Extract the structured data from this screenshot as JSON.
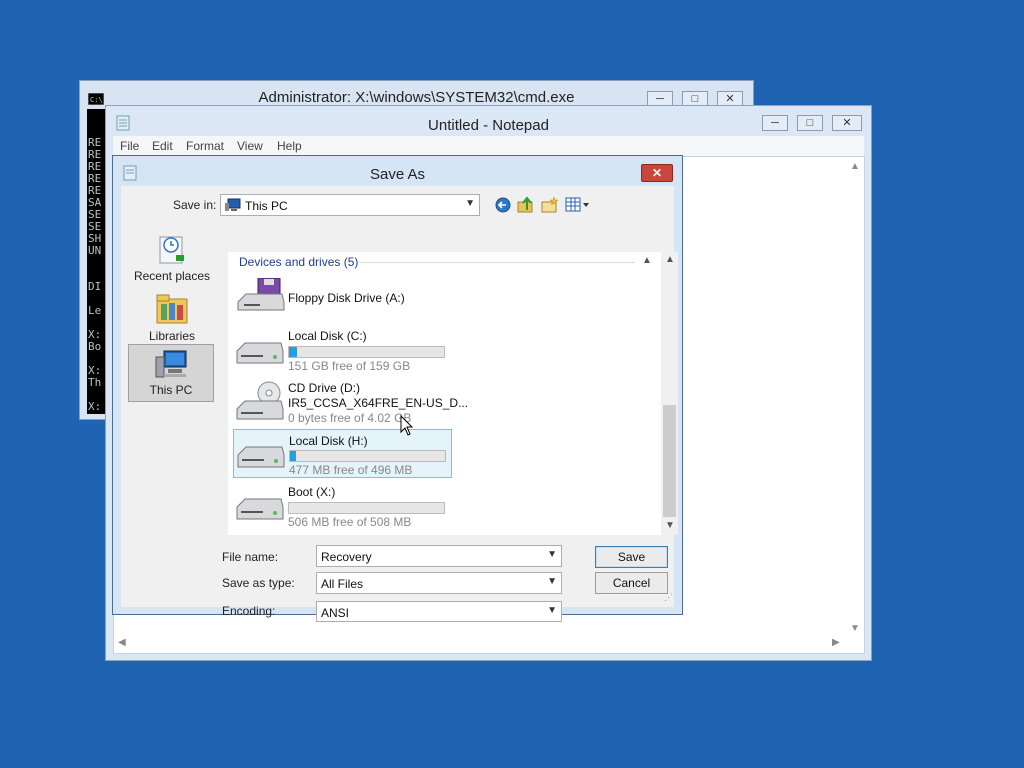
{
  "cmd_window": {
    "title": "Administrator: X:\\windows\\SYSTEM32\\cmd.exe",
    "console_lines": [
      "RE",
      "RE",
      "RE",
      "RE",
      "RE",
      "SA",
      "SE",
      "SE",
      "SH",
      "UN",
      "DI",
      "Le",
      "X:",
      "Bo",
      "X:",
      "Th",
      "X:"
    ]
  },
  "notepad_window": {
    "title": "Untitled - Notepad",
    "menu": [
      "File",
      "Edit",
      "Format",
      "View",
      "Help"
    ]
  },
  "save_dialog": {
    "title": "Save As",
    "save_in_label": "Save in:",
    "save_in_value": "This PC",
    "nav": [
      {
        "label": "Recent places",
        "icon": "recent-places-icon"
      },
      {
        "label": "Libraries",
        "icon": "libraries-icon"
      },
      {
        "label": "This PC",
        "icon": "this-pc-icon",
        "selected": true
      }
    ],
    "group_header": "Devices and drives (5)",
    "drives": [
      {
        "name": "Floppy Disk Drive (A:)",
        "icon": "floppy-drive-icon"
      },
      {
        "name": "Local Disk (C:)",
        "free": "151 GB free of 159 GB",
        "used_fraction": 0.05,
        "icon": "hard-drive-icon"
      },
      {
        "name": "CD Drive (D:)",
        "label": "IR5_CCSA_X64FRE_EN-US_D...",
        "free": "0 bytes free of 4.02 GB",
        "icon": "cd-drive-icon"
      },
      {
        "name": "Local Disk (H:)",
        "free": "477 MB free of 496 MB",
        "used_fraction": 0.04,
        "icon": "hard-drive-icon",
        "selected": true
      },
      {
        "name": "Boot (X:)",
        "free": "506 MB free of 508 MB",
        "used_fraction": 0.0,
        "icon": "hard-drive-icon"
      }
    ],
    "file_name_label": "File name:",
    "file_name_value": "Recovery",
    "save_as_type_label": "Save as type:",
    "save_as_type_value": "All Files",
    "encoding_label": "Encoding:",
    "encoding_value": "ANSI",
    "save_button": "Save",
    "cancel_button": "Cancel"
  },
  "colors": {
    "desktop": "#1f64b3",
    "accent_blue": "#26a0da",
    "close_red": "#c9463c"
  }
}
